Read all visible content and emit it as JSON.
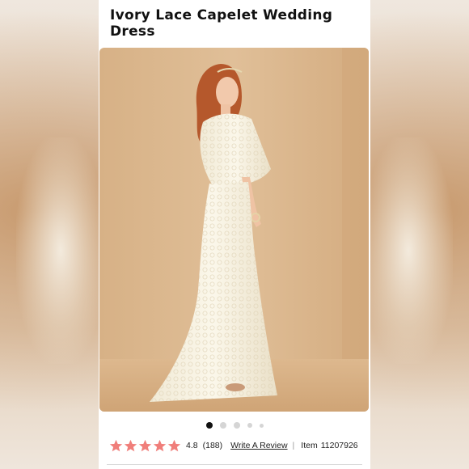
{
  "product": {
    "title": "Ivory Lace Capelet Wedding Dress"
  },
  "gallery": {
    "image_count": 5,
    "active_index": 0,
    "expand_icon": "expand-hand-icon"
  },
  "reviews": {
    "rating": "4.8",
    "count": "(188)",
    "stars": 5,
    "star_color": "#f07e7a",
    "write_review_label": "Write A Review",
    "separator": "|"
  },
  "item": {
    "label": "Item",
    "number": "11207926"
  }
}
